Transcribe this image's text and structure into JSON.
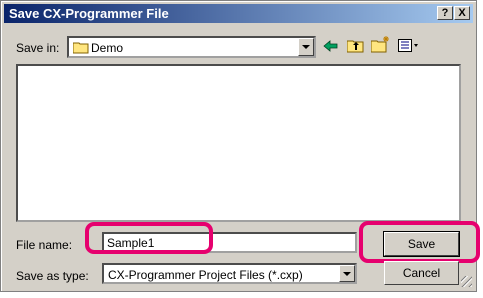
{
  "window": {
    "title": "Save CX-Programmer File",
    "help_label": "?",
    "close_label": "X"
  },
  "toolbar": {
    "save_in_label": "Save in:",
    "save_in_value": "Demo",
    "icons": [
      "folder-icon",
      "back-arrow-icon",
      "up-folder-icon",
      "new-folder-icon",
      "view-menu-icon"
    ]
  },
  "file_list": {
    "items": []
  },
  "file_name": {
    "label": "File name:",
    "value": "Sample1"
  },
  "save_as_type": {
    "label": "Save as type:",
    "value": "CX-Programmer Project Files (*.cxp)"
  },
  "buttons": {
    "save_label": "Save",
    "cancel_label": "Cancel"
  },
  "colors": {
    "title_bar_start": "#0a246a",
    "title_bar_end": "#a6caf0",
    "highlight": "#e6006e",
    "dialog_bg": "#d4d0c8"
  }
}
